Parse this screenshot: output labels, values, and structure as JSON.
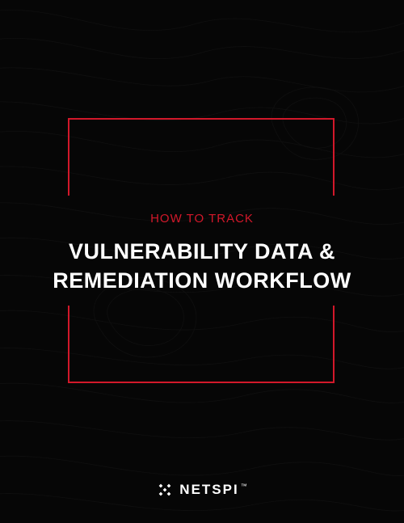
{
  "colors": {
    "background": "#060606",
    "accent": "#d2182a",
    "text": "#ffffff",
    "contour": "#2a2a2a"
  },
  "eyebrow": "HOW TO TRACK",
  "headline_line1": "VULNERABILITY DATA &",
  "headline_line2": "REMEDIATION WORKFLOW",
  "logo": {
    "icon_name": "netspi-cross-icon",
    "text": "NETSPI",
    "trademark": "™"
  }
}
